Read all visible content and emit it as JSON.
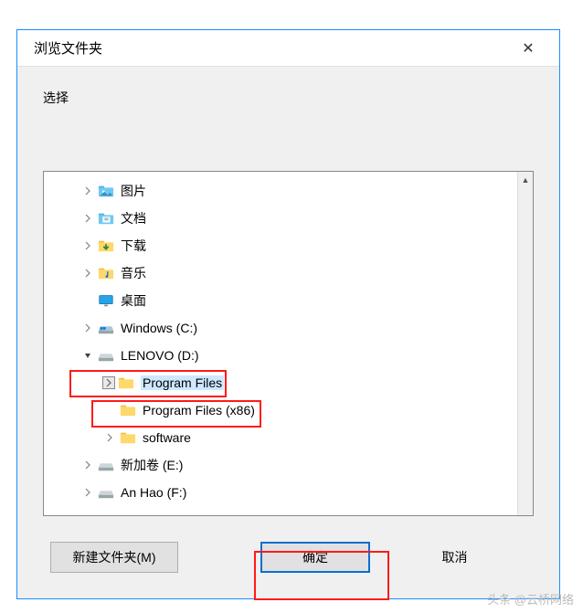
{
  "dialog": {
    "title": "浏览文件夹",
    "prompt": "选择"
  },
  "tree": {
    "items": [
      {
        "label": "图片",
        "icon": "pictures",
        "indent": 1,
        "expander": "closed"
      },
      {
        "label": "文档",
        "icon": "documents",
        "indent": 1,
        "expander": "closed"
      },
      {
        "label": "下载",
        "icon": "downloads",
        "indent": 1,
        "expander": "closed"
      },
      {
        "label": "音乐",
        "icon": "music",
        "indent": 1,
        "expander": "closed"
      },
      {
        "label": "桌面",
        "icon": "desktop",
        "indent": 1,
        "expander": "none"
      },
      {
        "label": "Windows (C:)",
        "icon": "osdrive",
        "indent": 1,
        "expander": "closed"
      },
      {
        "label": "LENOVO (D:)",
        "icon": "drive",
        "indent": 1,
        "expander": "open",
        "highlight": "red1"
      },
      {
        "label": "Program Files",
        "icon": "folder",
        "indent": 2,
        "expander": "closed",
        "selected": true,
        "highlight": "red2"
      },
      {
        "label": "Program Files (x86)",
        "icon": "folder",
        "indent": 2,
        "expander": "none"
      },
      {
        "label": "software",
        "icon": "folder",
        "indent": 2,
        "expander": "closed"
      },
      {
        "label": "新加卷 (E:)",
        "icon": "drive",
        "indent": 1,
        "expander": "closed"
      },
      {
        "label": "An Hao (F:)",
        "icon": "drive",
        "indent": 1,
        "expander": "closed"
      }
    ]
  },
  "buttons": {
    "new_folder": "新建文件夹(M)",
    "ok": "确定",
    "cancel": "取消"
  },
  "watermark": "头条 @云桥网络"
}
